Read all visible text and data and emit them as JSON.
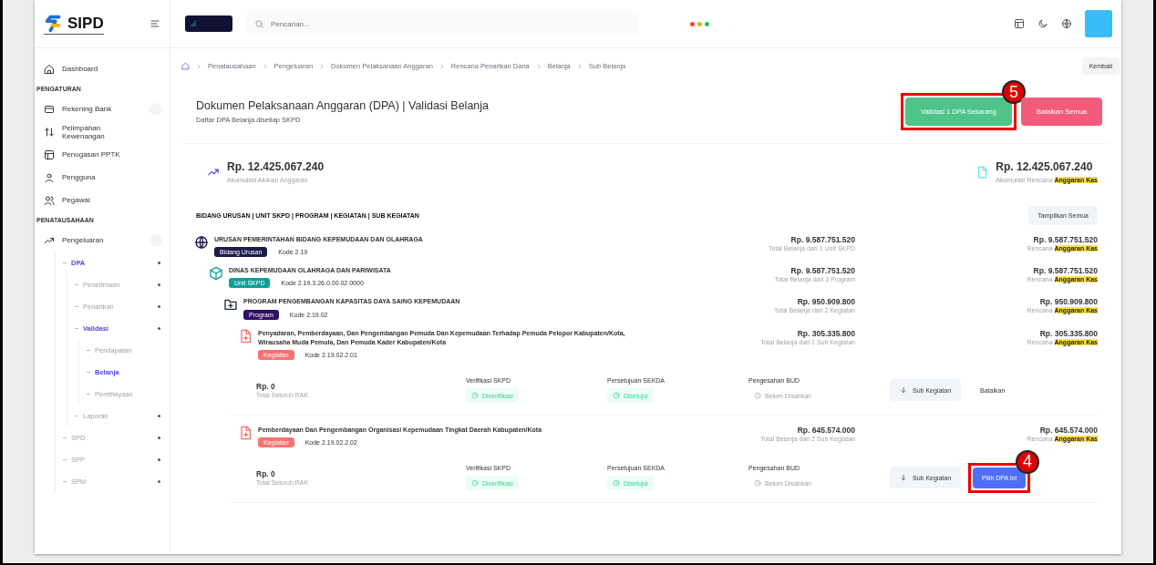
{
  "sidebar": {
    "logo": "SIPD",
    "items": [
      {
        "kind": "item",
        "label": "Dashboard",
        "selected": false
      },
      {
        "kind": "section",
        "label": "PENGATURAN"
      },
      {
        "kind": "item",
        "label": "Rekening Bank",
        "selected": false,
        "toggle": true
      },
      {
        "kind": "item",
        "label": "Pelimpahan Kewenangan",
        "selected": false
      },
      {
        "kind": "item",
        "label": "Penugasan PPTK",
        "selected": false
      },
      {
        "kind": "item",
        "label": "Pengguna",
        "selected": false
      },
      {
        "kind": "item",
        "label": "Pegawai",
        "selected": false
      },
      {
        "kind": "section",
        "label": "PENATAUSAHAAN"
      },
      {
        "kind": "item",
        "label": "Pengeluaran",
        "selected": false,
        "toggle": true,
        "children": [
          {
            "label": "DPA",
            "selected": true,
            "expandable": true,
            "children": [
              {
                "label": "Penerimaan",
                "selected": false,
                "expandable": true
              },
              {
                "label": "Penarikan",
                "selected": false,
                "expandable": true
              },
              {
                "label": "Validasi",
                "selected": true,
                "expandable": true,
                "children": [
                  {
                    "label": "Pendapatan",
                    "selected": false
                  },
                  {
                    "label": "Belanja",
                    "selected": true
                  },
                  {
                    "label": "Pembiayaan",
                    "selected": false
                  }
                ]
              },
              {
                "label": "Laporan",
                "selected": false,
                "expandable": true
              }
            ]
          },
          {
            "label": "SPD",
            "selected": false,
            "expandable": true
          },
          {
            "label": "SPP",
            "selected": false,
            "expandable": true
          },
          {
            "label": "SPM",
            "selected": false,
            "expandable": true
          }
        ]
      }
    ]
  },
  "topbar": {
    "search": {
      "placeholder": "Pencarian..."
    }
  },
  "breadcrumb": [
    "Penatausahaan",
    "Pengeluaran",
    "Dokumen Pelaksanaan Anggaran",
    "Rencana Penarikan Dana",
    "Belanja",
    "Sub Belanja"
  ],
  "back_button": "Kembali",
  "header": {
    "title": "Dokumen Pelaksanaan Anggaran (DPA) | Validasi Belanja",
    "subtitle": "Daftar DPA Belanja disetiap SKPD",
    "buttons": [
      {
        "label": "Validasi 1 DPA Sekarang",
        "kind": "success",
        "callout": "5"
      },
      {
        "label": "Batalkan Semua",
        "kind": "danger"
      }
    ]
  },
  "summary": [
    {
      "amount": "Rp. 12.425.067.240",
      "label": "Akumulasi Alokasi Anggaran"
    },
    {
      "amount": "Rp. 12.425.067.240",
      "label": "Akumulasi Rencana",
      "highlight": "Anggaran Kas"
    }
  ],
  "tree": {
    "heading": "BIDANG URUSAN | UNIT SKPD | PROGRAM | KEGIATAN | SUB KEGIATAN",
    "show_all": "Tampilkan Semua",
    "nodes": [
      {
        "kind": "urusan",
        "title": "URUSAN PEMERINTAHAN BIDANG KEPEMUDAAN DAN OLAHRAGA",
        "badge": "Bidang Urusan",
        "code": "Kode 2.19",
        "total": "Rp. 9.587.751.520",
        "total_label": "Total Belanja dari 1 Unit SKPD",
        "plan": "Rp. 9.587.751.520",
        "plan_label": "Rencana",
        "highlight": "Anggaran Kas",
        "children": [
          {
            "kind": "unit",
            "title": "DINAS KEPEMUDAAN OLAHRAGA DAN PARIWISATA",
            "badge": "Unit SKPD",
            "code": "Kode 2.19.3.26.0.00.02.0000",
            "total": "Rp. 9.587.751.520",
            "total_label": "Total Belanja dari 3 Program",
            "plan": "Rp. 9.587.751.520",
            "plan_label": "Rencana",
            "highlight": "Anggaran Kas",
            "children": [
              {
                "kind": "program",
                "title": "PROGRAM PENGEMBANGAN KAPASITAS DAYA SAING KEPEMUDAAN",
                "badge": "Program",
                "code": "Kode 2.19.02",
                "total": "Rp. 950.909.800",
                "total_label": "Total Belanja dari 2 Kegiatan",
                "plan": "Rp. 950.909.800",
                "plan_label": "Rencana",
                "highlight": "Anggaran Kas",
                "children": [
                  {
                    "kind": "kegiatan",
                    "title": "Penyadaran, Pemberdayaan, Dan Pengembangan Pemuda Dan Kepemudaan Terhadap Pemuda Pelopor Kabupaten/Kota, Wirausaha Muda Pemula, Dan Pemuda Kader Kabupaten/Kota",
                    "badge": "Kegiatan",
                    "code": "Kode 2.19.02.2.01",
                    "total": "Rp. 305.335.800",
                    "total_label": "Total Belanja dari 1 Sub Kegiatan",
                    "plan": "Rp. 305.335.800",
                    "plan_label": "Rencana",
                    "highlight": "Anggaran Kas",
                    "detail": {
                      "amount": "Rp. 0",
                      "amount_label": "Total Seluruh RAK",
                      "steps": [
                        {
                          "label": "Verifikasi SKPD",
                          "value": "Diverifikasi",
                          "done": true
                        },
                        {
                          "label": "Persetujuan SEKDA",
                          "value": "Disetujui",
                          "done": true
                        },
                        {
                          "label": "Pengesahan BUD",
                          "value": "Belum Disahkan",
                          "done": false
                        }
                      ],
                      "sub_button": "Sub Kegiatan",
                      "action": {
                        "label": "Batalkan",
                        "kind": "link"
                      }
                    }
                  },
                  {
                    "kind": "kegiatan",
                    "title": "Pemberdayaan Dan Pengembangan Organisasi Kepemudaan Tingkat Daerah Kabupaten/Kota",
                    "badge": "Kegiatan",
                    "code": "Kode 2.19.02.2.02",
                    "total": "Rp. 645.574.000",
                    "total_label": "Total Belanja dari 2 Sub Kegiatan",
                    "plan": "Rp. 645.574.000",
                    "plan_label": "Rencana",
                    "highlight": "Anggaran Kas",
                    "detail": {
                      "amount": "Rp. 0",
                      "amount_label": "Total Seluruh RAK",
                      "steps": [
                        {
                          "label": "Verifikasi SKPD",
                          "value": "Diverifikasi",
                          "done": true
                        },
                        {
                          "label": "Persetujuan SEKDA",
                          "value": "Disetujui",
                          "done": true
                        },
                        {
                          "label": "Pengesahan BUD",
                          "value": "Belum Disahkan",
                          "done": false
                        }
                      ],
                      "sub_button": "Sub Kegiatan",
                      "action": {
                        "label": "Pilih DPA Ini",
                        "kind": "primary",
                        "callout": "4"
                      }
                    }
                  }
                ]
              }
            ]
          }
        ]
      }
    ]
  }
}
